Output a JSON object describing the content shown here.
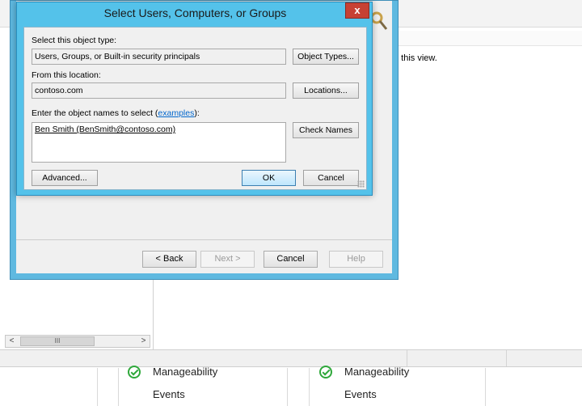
{
  "background": {
    "empty_view_text": "n this view.",
    "scrollbar_thumb_glyph": "III",
    "dashboard": {
      "columns": [
        {
          "manageability": "Manageability",
          "events": "Events"
        },
        {
          "manageability": "Manageability",
          "events": "Events"
        }
      ]
    }
  },
  "wizard": {
    "buttons": {
      "back": "< Back",
      "next": "Next >",
      "cancel": "Cancel",
      "help": "Help"
    }
  },
  "dialog": {
    "title": "Select Users, Computers, or Groups",
    "close_glyph": "x",
    "object_type_label": "Select this object type:",
    "object_type_value": "Users, Groups, or Built-in security principals",
    "object_types_button": "Object Types...",
    "location_label": "From this location:",
    "location_value": "contoso.com",
    "locations_button": "Locations...",
    "names_label_prefix": "Enter the object names to select (",
    "names_label_link": "examples",
    "names_label_suffix": "):",
    "names_value": "Ben Smith (BenSmith@contoso.com)",
    "check_names_button": "Check Names",
    "advanced_button": "Advanced...",
    "ok_button": "OK",
    "cancel_button": "Cancel"
  },
  "colors": {
    "dialog_frame": "#54c2ea",
    "close_button": "#c74134",
    "ok_status": "#2fa83b",
    "link": "#0066cc"
  }
}
